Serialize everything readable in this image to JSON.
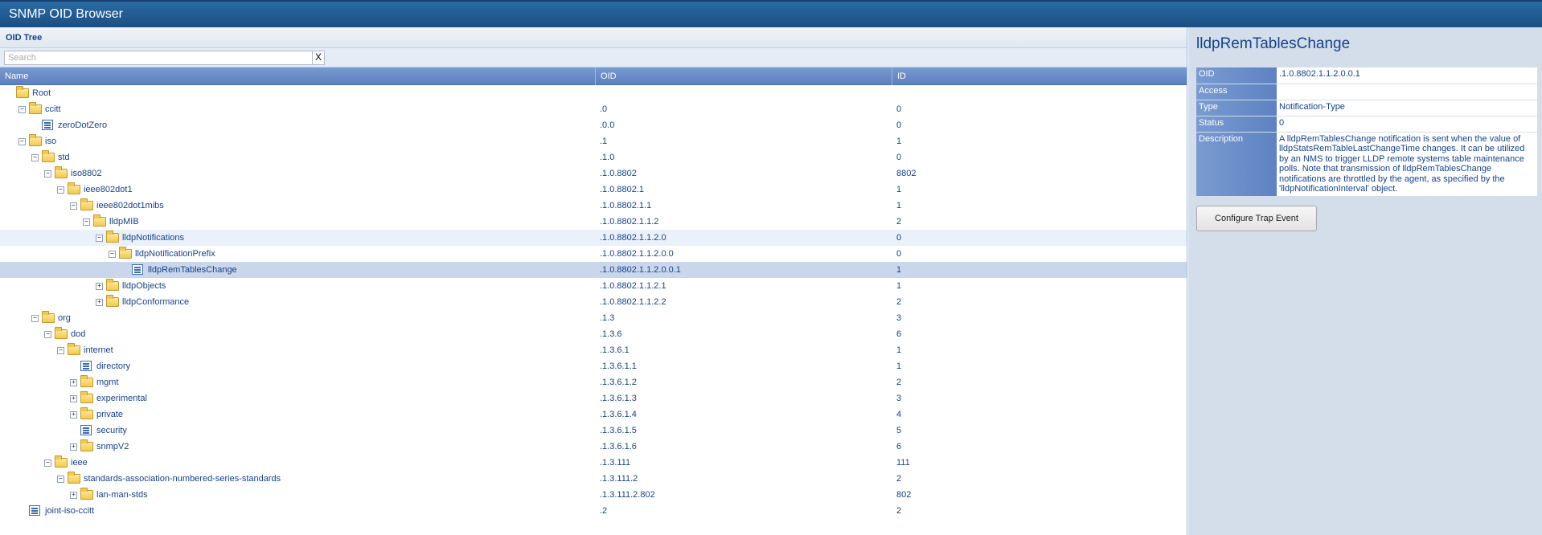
{
  "app": {
    "title": "SNMP OID Browser"
  },
  "tree_panel": {
    "header": "OID Tree",
    "search_placeholder": "Search",
    "clear_label": "X",
    "columns": {
      "name": "Name",
      "oid": "OID",
      "id": "ID"
    }
  },
  "rows": [
    {
      "name": "Root",
      "oid": "",
      "id": "",
      "depth": 0,
      "type": "folder",
      "toggle": ""
    },
    {
      "name": "ccitt",
      "oid": ".0",
      "id": "0",
      "depth": 1,
      "type": "folder",
      "toggle": "-"
    },
    {
      "name": "zeroDotZero",
      "oid": ".0.0",
      "id": "0",
      "depth": 2,
      "type": "leaf",
      "toggle": ""
    },
    {
      "name": "iso",
      "oid": ".1",
      "id": "1",
      "depth": 1,
      "type": "folder",
      "toggle": "-"
    },
    {
      "name": "std",
      "oid": ".1.0",
      "id": "0",
      "depth": 2,
      "type": "folder",
      "toggle": "-"
    },
    {
      "name": "iso8802",
      "oid": ".1.0.8802",
      "id": "8802",
      "depth": 3,
      "type": "folder",
      "toggle": "-"
    },
    {
      "name": "ieee802dot1",
      "oid": ".1.0.8802.1",
      "id": "1",
      "depth": 4,
      "type": "folder",
      "toggle": "-"
    },
    {
      "name": "ieee802dot1mibs",
      "oid": ".1.0.8802.1.1",
      "id": "1",
      "depth": 5,
      "type": "folder",
      "toggle": "-"
    },
    {
      "name": "lldpMIB",
      "oid": ".1.0.8802.1.1.2",
      "id": "2",
      "depth": 6,
      "type": "folder",
      "toggle": "-"
    },
    {
      "name": "lldpNotifications",
      "oid": ".1.0.8802.1.1.2.0",
      "id": "0",
      "depth": 7,
      "type": "folder",
      "toggle": "-",
      "state": "alt"
    },
    {
      "name": "lldpNotificationPrefix",
      "oid": ".1.0.8802.1.1.2.0.0",
      "id": "0",
      "depth": 8,
      "type": "folder",
      "toggle": "-"
    },
    {
      "name": "lldpRemTablesChange",
      "oid": ".1.0.8802.1.1.2.0.0.1",
      "id": "1",
      "depth": 9,
      "type": "leaf",
      "toggle": "",
      "state": "selected"
    },
    {
      "name": "lldpObjects",
      "oid": ".1.0.8802.1.1.2.1",
      "id": "1",
      "depth": 7,
      "type": "folder",
      "toggle": "+"
    },
    {
      "name": "lldpConformance",
      "oid": ".1.0.8802.1.1.2.2",
      "id": "2",
      "depth": 7,
      "type": "folder",
      "toggle": "+"
    },
    {
      "name": "org",
      "oid": ".1.3",
      "id": "3",
      "depth": 2,
      "type": "folder",
      "toggle": "-"
    },
    {
      "name": "dod",
      "oid": ".1.3.6",
      "id": "6",
      "depth": 3,
      "type": "folder",
      "toggle": "-"
    },
    {
      "name": "internet",
      "oid": ".1.3.6.1",
      "id": "1",
      "depth": 4,
      "type": "folder",
      "toggle": "-"
    },
    {
      "name": "directory",
      "oid": ".1.3.6.1.1",
      "id": "1",
      "depth": 5,
      "type": "leaf",
      "toggle": ""
    },
    {
      "name": "mgmt",
      "oid": ".1.3.6.1.2",
      "id": "2",
      "depth": 5,
      "type": "folder",
      "toggle": "+"
    },
    {
      "name": "experimental",
      "oid": ".1.3.6.1.3",
      "id": "3",
      "depth": 5,
      "type": "folder",
      "toggle": "+"
    },
    {
      "name": "private",
      "oid": ".1.3.6.1.4",
      "id": "4",
      "depth": 5,
      "type": "folder",
      "toggle": "+"
    },
    {
      "name": "security",
      "oid": ".1.3.6.1.5",
      "id": "5",
      "depth": 5,
      "type": "leaf",
      "toggle": ""
    },
    {
      "name": "snmpV2",
      "oid": ".1.3.6.1.6",
      "id": "6",
      "depth": 5,
      "type": "folder",
      "toggle": "+"
    },
    {
      "name": "ieee",
      "oid": ".1.3.111",
      "id": "111",
      "depth": 3,
      "type": "folder",
      "toggle": "-"
    },
    {
      "name": "standards-association-numbered-series-standards",
      "oid": ".1.3.111.2",
      "id": "2",
      "depth": 4,
      "type": "folder",
      "toggle": "-"
    },
    {
      "name": "lan-man-stds",
      "oid": ".1.3.111.2.802",
      "id": "802",
      "depth": 5,
      "type": "folder",
      "toggle": "+"
    },
    {
      "name": "joint-iso-ccitt",
      "oid": ".2",
      "id": "2",
      "depth": 1,
      "type": "leaf",
      "toggle": ""
    }
  ],
  "detail": {
    "title": "lldpRemTablesChange",
    "props": {
      "oid": {
        "label": "OID",
        "value": ".1.0.8802.1.1.2.0.0.1"
      },
      "access": {
        "label": "Access",
        "value": ""
      },
      "type": {
        "label": "Type",
        "value": "Notification-Type"
      },
      "status": {
        "label": "Status",
        "value": "0"
      },
      "description": {
        "label": "Description",
        "value": "A lldpRemTablesChange notification is sent when the value of lldpStatsRemTableLastChangeTime changes. It can be utilized by an NMS to trigger LLDP remote systems table maintenance polls. Note that transmission of lldpRemTablesChange notifications are throttled by the agent, as specified by the 'lldpNotificationInterval' object."
      }
    },
    "button_label": "Configure Trap Event"
  }
}
